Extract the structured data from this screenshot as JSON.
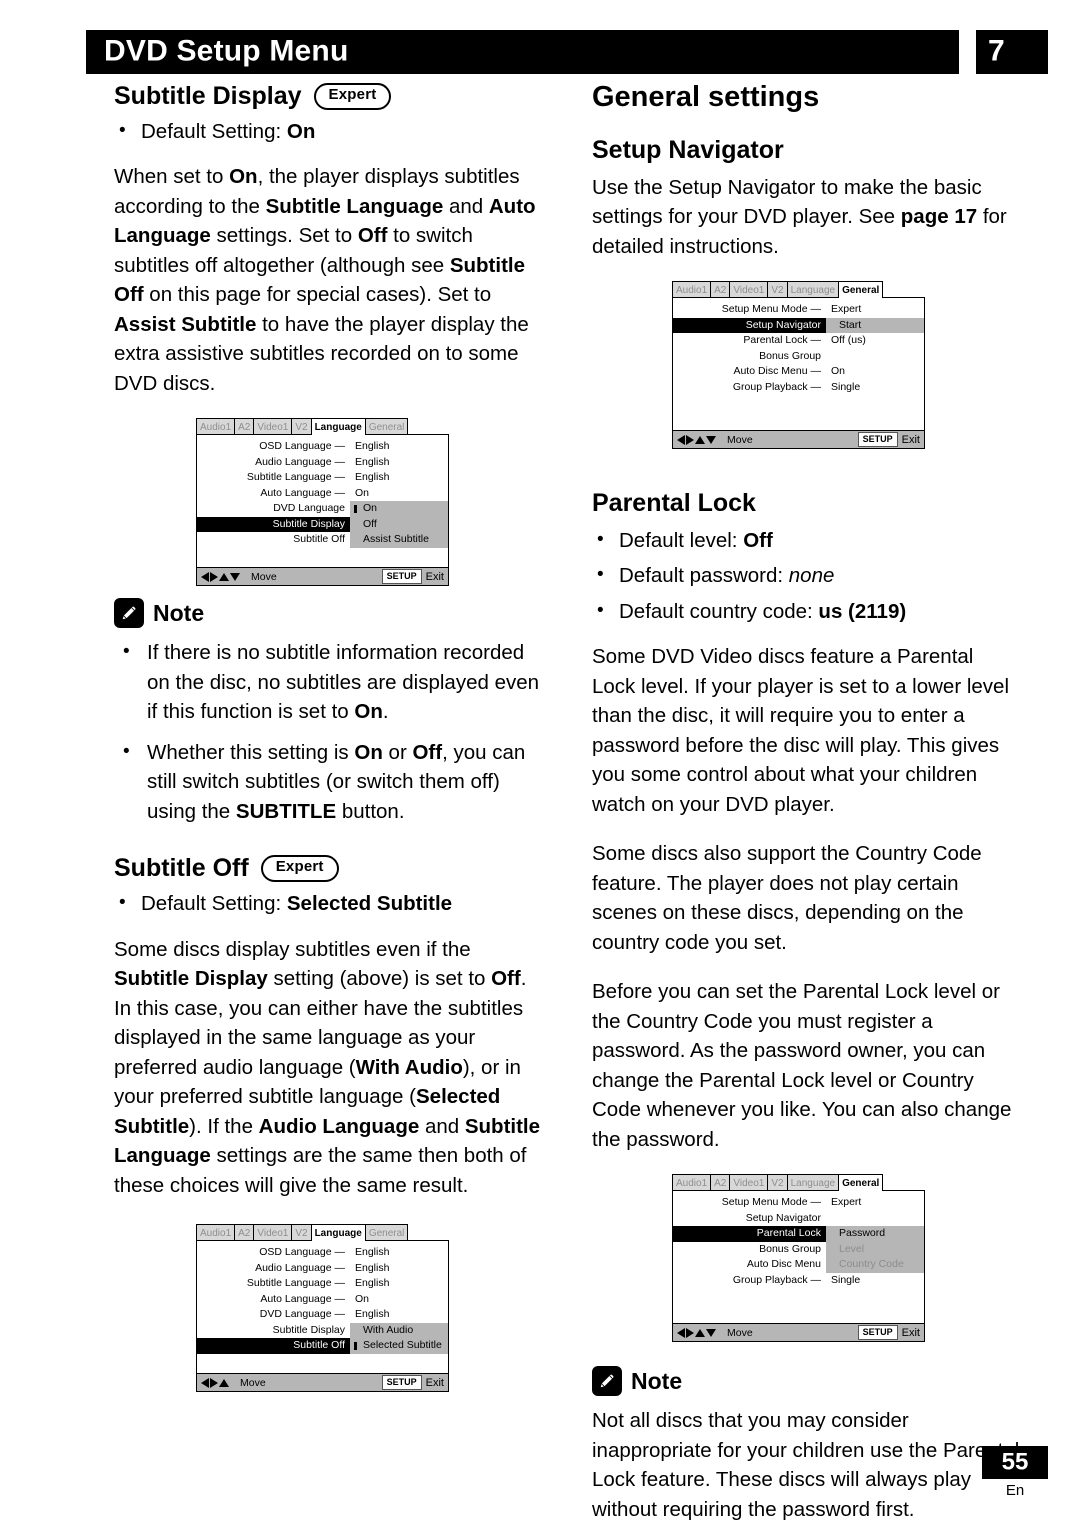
{
  "header": {
    "title": "DVD Setup Menu",
    "chapter": "7"
  },
  "footer": {
    "page_number": "55",
    "language_code": "En"
  },
  "left_column": {
    "subtitle_display": {
      "heading": "Subtitle Display",
      "badge": "Expert",
      "bullets": [
        "Default Setting: On"
      ],
      "body": "When set to On, the player displays subtitles according to the Subtitle Language and Auto Language settings. Set to Off to switch subtitles off altogether (although see Subtitle Off on this page for special cases). Set to Assist Subtitle to have the player display the extra assistive subtitles recorded on to some DVD discs."
    },
    "note1": {
      "icon": "pencil-icon",
      "label": "Note",
      "items": [
        "If there is no subtitle information recorded on the disc, no subtitles are displayed even if this function is set to On.",
        "Whether this setting is On or Off, you can still switch subtitles (or switch them off) using the SUBTITLE button."
      ]
    },
    "subtitle_off": {
      "heading": "Subtitle Off",
      "badge": "Expert",
      "bullets": [
        "Default Setting: Selected Subtitle"
      ],
      "body": "Some discs display subtitles even if the Subtitle Display setting (above) is set to Off. In this case, you can either have the subtitles displayed in the same language as your preferred audio language (With Audio), or in your preferred subtitle language (Selected Subtitle). If the Audio Language and Subtitle Language settings are the same then both of these choices will give the same result."
    }
  },
  "right_column": {
    "general_settings": {
      "heading": "General settings"
    },
    "setup_navigator": {
      "heading": "Setup Navigator",
      "body": "Use the Setup Navigator to make the basic settings for your DVD player. See page 17 for detailed instructions."
    },
    "parental_lock": {
      "heading": "Parental Lock",
      "bullets": [
        "Default level: Off",
        "Default password: none",
        "Default country code: us (2119)"
      ],
      "paragraphs": [
        "Some DVD Video discs feature a Parental Lock level. If your player is set to a lower level than the disc, it will require you to enter a password before the disc will play. This gives you some control about what your children watch on your DVD player.",
        "Some discs also support the Country Code feature. The player does not play certain scenes on these discs, depending on the country code you set.",
        "Before you can set the Parental Lock level or the Country Code you must register a password. As the password owner, you can change the Parental Lock level or Country Code whenever you like. You can also change the password."
      ]
    },
    "note2": {
      "icon": "pencil-icon",
      "label": "Note",
      "text": "Not all discs that you may consider inappropriate for your children use the Parental Lock feature. These discs will always play without requiring the password first."
    }
  },
  "osd_screens": [
    {
      "id": "osd-language-subtitle-display",
      "tabs": [
        {
          "label": "Audio1",
          "active": false
        },
        {
          "label": "A2",
          "active": false
        },
        {
          "label": "Video1",
          "active": false
        },
        {
          "label": "V2",
          "active": false
        },
        {
          "label": "Language",
          "active": true
        },
        {
          "label": "General",
          "active": false
        }
      ],
      "rows": [
        {
          "label": "OSD Language —",
          "value": "English",
          "highlight": false
        },
        {
          "label": "Audio Language —",
          "value": "English",
          "highlight": false
        },
        {
          "label": "Subtitle Language —",
          "value": "English",
          "highlight": false
        },
        {
          "label": "Auto Language —",
          "value": "On",
          "highlight": false
        },
        {
          "label": "DVD Language",
          "value": "",
          "highlight": false
        },
        {
          "label": "Subtitle Display",
          "value": "",
          "highlight": true
        },
        {
          "label": "Subtitle Off",
          "value": "",
          "highlight": false
        }
      ],
      "popup": {
        "top_row_index": 4,
        "items": [
          {
            "label": "On",
            "selected": true,
            "dim": false
          },
          {
            "label": "Off",
            "selected": false,
            "dim": false
          },
          {
            "label": "Assist Subtitle",
            "selected": false,
            "dim": false
          }
        ]
      },
      "footer": {
        "arrows": [
          "left",
          "right",
          "up",
          "down"
        ],
        "move_label": "Move",
        "setup_label": "SETUP",
        "exit_label": "Exit"
      }
    },
    {
      "id": "osd-language-subtitle-off",
      "tabs": [
        {
          "label": "Audio1",
          "active": false
        },
        {
          "label": "A2",
          "active": false
        },
        {
          "label": "Video1",
          "active": false
        },
        {
          "label": "V2",
          "active": false
        },
        {
          "label": "Language",
          "active": true
        },
        {
          "label": "General",
          "active": false
        }
      ],
      "rows": [
        {
          "label": "OSD Language —",
          "value": "English",
          "highlight": false
        },
        {
          "label": "Audio Language —",
          "value": "English",
          "highlight": false
        },
        {
          "label": "Subtitle Language —",
          "value": "English",
          "highlight": false
        },
        {
          "label": "Auto Language —",
          "value": "On",
          "highlight": false
        },
        {
          "label": "DVD Language —",
          "value": "English",
          "highlight": false
        },
        {
          "label": "Subtitle Display",
          "value": "",
          "highlight": false
        },
        {
          "label": "Subtitle Off",
          "value": "",
          "highlight": true
        }
      ],
      "popup": {
        "top_row_index": 5,
        "items": [
          {
            "label": "With Audio",
            "selected": false,
            "dim": false
          },
          {
            "label": "Selected Subtitle",
            "selected": true,
            "dim": false
          }
        ]
      },
      "footer": {
        "arrows": [
          "left",
          "right",
          "up"
        ],
        "move_label": "Move",
        "setup_label": "SETUP",
        "exit_label": "Exit"
      }
    },
    {
      "id": "osd-general-setup-navigator",
      "tabs": [
        {
          "label": "Audio1",
          "active": false
        },
        {
          "label": "A2",
          "active": false
        },
        {
          "label": "Video1",
          "active": false
        },
        {
          "label": "V2",
          "active": false
        },
        {
          "label": "Language",
          "active": false
        },
        {
          "label": "General",
          "active": true
        }
      ],
      "rows": [
        {
          "label": "Setup Menu Mode —",
          "value": "Expert",
          "highlight": false
        },
        {
          "label": "Setup Navigator",
          "value": "",
          "highlight": true
        },
        {
          "label": "Parental Lock —",
          "value": "Off (us)",
          "highlight": false
        },
        {
          "label": "Bonus Group",
          "value": "",
          "highlight": false
        },
        {
          "label": "Auto Disc Menu —",
          "value": "On",
          "highlight": false
        },
        {
          "label": "Group Playback —",
          "value": "Single",
          "highlight": false
        }
      ],
      "popup": {
        "top_row_index": 1,
        "items": [
          {
            "label": "Start",
            "selected": false,
            "dim": false
          }
        ]
      },
      "footer": {
        "arrows": [
          "left",
          "right",
          "up",
          "down"
        ],
        "move_label": "Move",
        "setup_label": "SETUP",
        "exit_label": "Exit"
      }
    },
    {
      "id": "osd-general-parental-lock",
      "tabs": [
        {
          "label": "Audio1",
          "active": false
        },
        {
          "label": "A2",
          "active": false
        },
        {
          "label": "Video1",
          "active": false
        },
        {
          "label": "V2",
          "active": false
        },
        {
          "label": "Language",
          "active": false
        },
        {
          "label": "General",
          "active": true
        }
      ],
      "rows": [
        {
          "label": "Setup Menu Mode —",
          "value": "Expert",
          "highlight": false
        },
        {
          "label": "Setup Navigator",
          "value": "",
          "highlight": false
        },
        {
          "label": "Parental Lock",
          "value": "",
          "highlight": true
        },
        {
          "label": "Bonus Group",
          "value": "",
          "highlight": false
        },
        {
          "label": "Auto Disc Menu",
          "value": "",
          "highlight": false
        },
        {
          "label": "Group Playback —",
          "value": "Single",
          "highlight": false
        }
      ],
      "popup": {
        "top_row_index": 2,
        "items": [
          {
            "label": "Password",
            "selected": false,
            "dim": false
          },
          {
            "label": "Level",
            "selected": false,
            "dim": true
          },
          {
            "label": "Country Code",
            "selected": false,
            "dim": true
          }
        ]
      },
      "footer": {
        "arrows": [
          "left",
          "right",
          "up",
          "down"
        ],
        "move_label": "Move",
        "setup_label": "SETUP",
        "exit_label": "Exit"
      }
    }
  ]
}
